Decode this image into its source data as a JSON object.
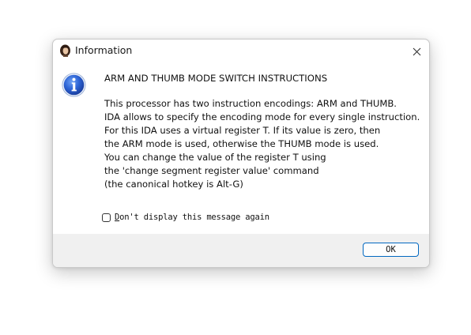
{
  "window": {
    "title": "Information",
    "app_icon": "ida-pro-icon",
    "close_icon": "close-icon"
  },
  "message": {
    "icon": "info-icon",
    "heading": "ARM AND THUMB MODE SWITCH INSTRUCTIONS",
    "lines": [
      "This processor has two instruction encodings: ARM and THUMB.",
      "IDA allows to specify the encoding mode for every single instruction.",
      "For this IDA uses a virtual register T. If its value is zero, then",
      "the ARM mode is used, otherwise the THUMB mode is used.",
      "You can change the value of the register T using",
      "the 'change segment register value' command",
      "(the canonical hotkey is Alt-G)"
    ]
  },
  "options": {
    "dont_display_label_mnemonic": "D",
    "dont_display_label_rest": "on't display this message again",
    "dont_display_checked": false
  },
  "buttons": {
    "ok_label": "OK"
  },
  "colors": {
    "accent": "#0067c0",
    "info_icon_blue": "#1e56c8",
    "footer_bg": "#f0f0f0"
  }
}
